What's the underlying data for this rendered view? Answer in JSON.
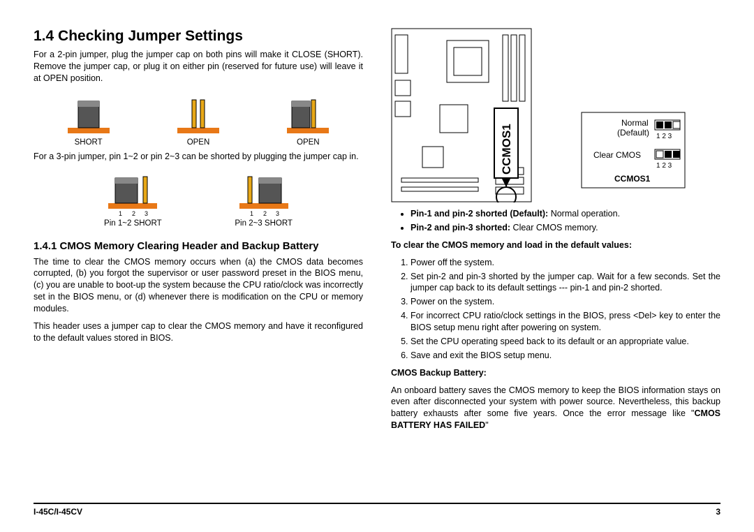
{
  "section_title": "1.4 Checking Jumper Settings",
  "intro_2pin": "For a 2-pin jumper, plug the jumper cap on both pins will make it CLOSE (SHORT). Remove the jumper cap, or plug it on either pin (reserved for future use) will leave it at OPEN position.",
  "labels_2pin": [
    "SHORT",
    "OPEN",
    "OPEN"
  ],
  "intro_3pin": "For a 3-pin jumper, pin 1~2 or pin 2~3 can be shorted by plugging the jumper cap in.",
  "labels_3pin": [
    "Pin 1~2 SHORT",
    "Pin 2~3 SHORT"
  ],
  "subsection_title": "1.4.1 CMOS Memory Clearing Header and Backup Battery",
  "para_cmos1": "The time to clear the CMOS memory occurs when (a) the CMOS data becomes corrupted, (b) you forgot the supervisor or user password preset in the BIOS menu, (c) you are unable to boot-up the system because the CPU ratio/clock was incorrectly set in the BIOS menu, or (d) whenever there is modification on the CPU or memory modules.",
  "para_cmos2": "This header uses a jumper cap to clear the CMOS memory and have it reconfigured to the default values stored in BIOS.",
  "motherboard_label": "CCMOS1",
  "legend": {
    "normal_label": "Normal",
    "normal_sub": "(Default)",
    "clear_label": "Clear CMOS",
    "pins": "1 2 3",
    "footer": "CCMOS1"
  },
  "bullet1_bold": "Pin-1 and pin-2 shorted (Default):",
  "bullet1_rest": " Normal operation.",
  "bullet2_bold": "Pin-2 and pin-3 shorted:",
  "bullet2_rest": " Clear CMOS memory.",
  "procedure_title": "To clear the CMOS memory and load in the default values:",
  "steps": [
    "Power off the system.",
    "Set pin-2 and pin-3 shorted by the jumper cap. Wait for a few seconds. Set the jumper cap back to its default settings --- pin-1 and pin-2 shorted.",
    "Power on the system.",
    "For incorrect CPU ratio/clock settings in the BIOS, press <Del> key to enter the BIOS setup menu right after powering on system.",
    "Set the CPU operating speed back to its default or an appropriate value.",
    "Save and exit the BIOS setup menu."
  ],
  "backup_title": "CMOS Backup Battery:",
  "backup_para_pre": "An onboard battery saves the CMOS memory to keep the BIOS information stays on even after disconnected your system with power source. Nevertheless, this backup battery exhausts after some five years. Once the error message like \"",
  "backup_para_bold": "CMOS BATTERY HAS FAILED",
  "backup_para_post": "\"",
  "footer_left": "I-45C/I-45CV",
  "footer_right": "3"
}
